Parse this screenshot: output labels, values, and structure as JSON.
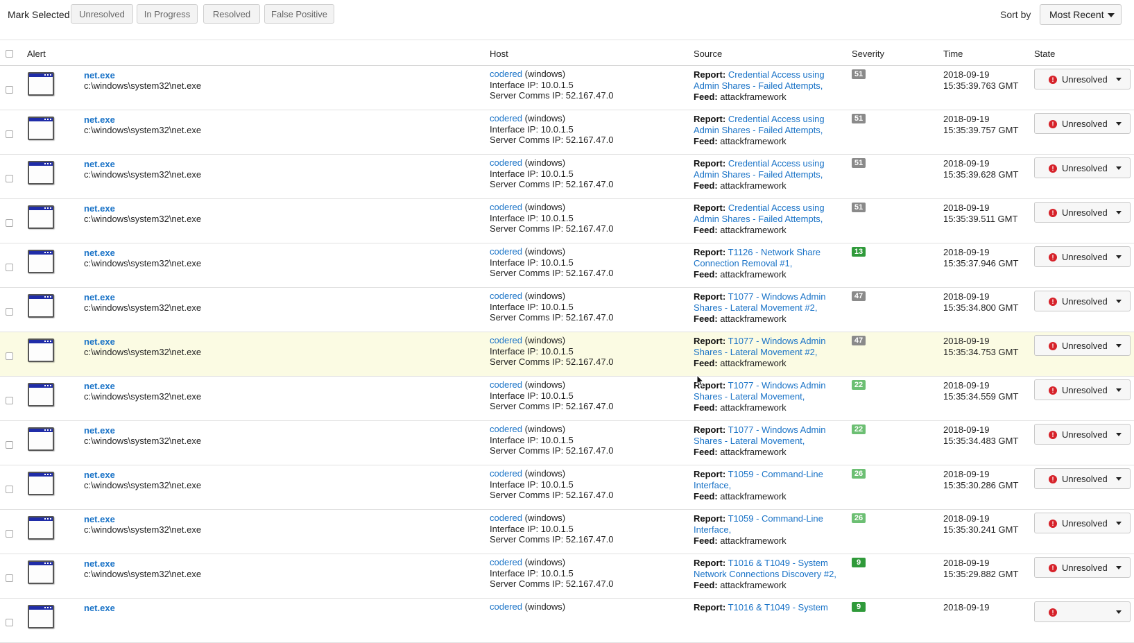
{
  "toolbar": {
    "mark_label": "Mark Selected",
    "buttons": [
      "Unresolved",
      "In Progress",
      "Resolved",
      "False Positive"
    ],
    "sort_label": "Sort by",
    "sort_value": "Most Recent"
  },
  "columns": {
    "alert": "Alert",
    "host": "Host",
    "source": "Source",
    "severity": "Severity",
    "time": "Time",
    "state": "State"
  },
  "colors": {
    "link": "#1a73c7",
    "sev_gray": "#8a8a8a",
    "sev_green": "#2f9a3a",
    "sev_light_green": "#6cbf73",
    "highlight_row": "#fbfbe3",
    "unresolved_icon": "#d6222a"
  },
  "icons": {
    "app": "application-window-icon",
    "state": "exclamation-circle-icon",
    "caret": "caret-down-icon"
  },
  "rows": [
    {
      "name": "net.exe",
      "path": "c:\\windows\\system32\\net.exe",
      "host_name": "codered",
      "host_os": "(windows)",
      "iface": "Interface IP: 10.0.1.5",
      "comms": "Server Comms IP: 52.167.47.0",
      "report_label": "Report:",
      "report_l1": "Credential Access using",
      "report_l2": "Admin Shares - Failed Attempts,",
      "feed_label": "Feed:",
      "feed": "attackframework",
      "severity": "51",
      "sev_color": "#8a8a8a",
      "date": "2018-09-19",
      "clock": "15:35:39.763 GMT",
      "state": "Unresolved"
    },
    {
      "name": "net.exe",
      "path": "c:\\windows\\system32\\net.exe",
      "host_name": "codered",
      "host_os": "(windows)",
      "iface": "Interface IP: 10.0.1.5",
      "comms": "Server Comms IP: 52.167.47.0",
      "report_label": "Report:",
      "report_l1": "Credential Access using",
      "report_l2": "Admin Shares - Failed Attempts,",
      "feed_label": "Feed:",
      "feed": "attackframework",
      "severity": "51",
      "sev_color": "#8a8a8a",
      "date": "2018-09-19",
      "clock": "15:35:39.757 GMT",
      "state": "Unresolved"
    },
    {
      "name": "net.exe",
      "path": "c:\\windows\\system32\\net.exe",
      "host_name": "codered",
      "host_os": "(windows)",
      "iface": "Interface IP: 10.0.1.5",
      "comms": "Server Comms IP: 52.167.47.0",
      "report_label": "Report:",
      "report_l1": "Credential Access using",
      "report_l2": "Admin Shares - Failed Attempts,",
      "feed_label": "Feed:",
      "feed": "attackframework",
      "severity": "51",
      "sev_color": "#8a8a8a",
      "date": "2018-09-19",
      "clock": "15:35:39.628 GMT",
      "state": "Unresolved"
    },
    {
      "name": "net.exe",
      "path": "c:\\windows\\system32\\net.exe",
      "host_name": "codered",
      "host_os": "(windows)",
      "iface": "Interface IP: 10.0.1.5",
      "comms": "Server Comms IP: 52.167.47.0",
      "report_label": "Report:",
      "report_l1": "Credential Access using",
      "report_l2": "Admin Shares - Failed Attempts,",
      "feed_label": "Feed:",
      "feed": "attackframework",
      "severity": "51",
      "sev_color": "#8a8a8a",
      "date": "2018-09-19",
      "clock": "15:35:39.511 GMT",
      "state": "Unresolved"
    },
    {
      "name": "net.exe",
      "path": "c:\\windows\\system32\\net.exe",
      "host_name": "codered",
      "host_os": "(windows)",
      "iface": "Interface IP: 10.0.1.5",
      "comms": "Server Comms IP: 52.167.47.0",
      "report_label": "Report:",
      "report_l1": "T1126 - Network Share",
      "report_l2": "Connection Removal #1,",
      "feed_label": "Feed:",
      "feed": "attackframework",
      "severity": "13",
      "sev_color": "#2f9a3a",
      "date": "2018-09-19",
      "clock": "15:35:37.946 GMT",
      "state": "Unresolved"
    },
    {
      "name": "net.exe",
      "path": "c:\\windows\\system32\\net.exe",
      "host_name": "codered",
      "host_os": "(windows)",
      "iface": "Interface IP: 10.0.1.5",
      "comms": "Server Comms IP: 52.167.47.0",
      "report_label": "Report:",
      "report_l1": "T1077 - Windows Admin",
      "report_l2": "Shares - Lateral Movement #2,",
      "feed_label": "Feed:",
      "feed": "attackframework",
      "severity": "47",
      "sev_color": "#8a8a8a",
      "date": "2018-09-19",
      "clock": "15:35:34.800 GMT",
      "state": "Unresolved"
    },
    {
      "name": "net.exe",
      "path": "c:\\windows\\system32\\net.exe",
      "host_name": "codered",
      "host_os": "(windows)",
      "iface": "Interface IP: 10.0.1.5",
      "comms": "Server Comms IP: 52.167.47.0",
      "report_label": "Report:",
      "report_l1": "T1077 - Windows Admin",
      "report_l2": "Shares - Lateral Movement #2,",
      "feed_label": "Feed:",
      "feed": "attackframework",
      "severity": "47",
      "sev_color": "#8a8a8a",
      "date": "2018-09-19",
      "clock": "15:35:34.753 GMT",
      "state": "Unresolved",
      "highlight": true
    },
    {
      "name": "net.exe",
      "path": "c:\\windows\\system32\\net.exe",
      "host_name": "codered",
      "host_os": "(windows)",
      "iface": "Interface IP: 10.0.1.5",
      "comms": "Server Comms IP: 52.167.47.0",
      "report_label": "Report:",
      "report_l1": "T1077 - Windows Admin",
      "report_l2": "Shares - Lateral Movement,",
      "feed_label": "Feed:",
      "feed": "attackframework",
      "severity": "22",
      "sev_color": "#6cbf73",
      "date": "2018-09-19",
      "clock": "15:35:34.559 GMT",
      "state": "Unresolved"
    },
    {
      "name": "net.exe",
      "path": "c:\\windows\\system32\\net.exe",
      "host_name": "codered",
      "host_os": "(windows)",
      "iface": "Interface IP: 10.0.1.5",
      "comms": "Server Comms IP: 52.167.47.0",
      "report_label": "Report:",
      "report_l1": "T1077 - Windows Admin",
      "report_l2": "Shares - Lateral Movement,",
      "feed_label": "Feed:",
      "feed": "attackframework",
      "severity": "22",
      "sev_color": "#6cbf73",
      "date": "2018-09-19",
      "clock": "15:35:34.483 GMT",
      "state": "Unresolved"
    },
    {
      "name": "net.exe",
      "path": "c:\\windows\\system32\\net.exe",
      "host_name": "codered",
      "host_os": "(windows)",
      "iface": "Interface IP: 10.0.1.5",
      "comms": "Server Comms IP: 52.167.47.0",
      "report_label": "Report:",
      "report_l1": "T1059 - Command-Line",
      "report_l2": "Interface,",
      "feed_label": "Feed:",
      "feed": "attackframework",
      "severity": "26",
      "sev_color": "#6cbf73",
      "date": "2018-09-19",
      "clock": "15:35:30.286 GMT",
      "state": "Unresolved"
    },
    {
      "name": "net.exe",
      "path": "c:\\windows\\system32\\net.exe",
      "host_name": "codered",
      "host_os": "(windows)",
      "iface": "Interface IP: 10.0.1.5",
      "comms": "Server Comms IP: 52.167.47.0",
      "report_label": "Report:",
      "report_l1": "T1059 - Command-Line",
      "report_l2": "Interface,",
      "feed_label": "Feed:",
      "feed": "attackframework",
      "severity": "26",
      "sev_color": "#6cbf73",
      "date": "2018-09-19",
      "clock": "15:35:30.241 GMT",
      "state": "Unresolved"
    },
    {
      "name": "net.exe",
      "path": "c:\\windows\\system32\\net.exe",
      "host_name": "codered",
      "host_os": "(windows)",
      "iface": "Interface IP: 10.0.1.5",
      "comms": "Server Comms IP: 52.167.47.0",
      "report_label": "Report:",
      "report_l1": "T1016 & T1049 - System",
      "report_l2": "Network Connections Discovery #2,",
      "feed_label": "Feed:",
      "feed": "attackframework",
      "severity": "9",
      "sev_color": "#2f9a3a",
      "date": "2018-09-19",
      "clock": "15:35:29.882 GMT",
      "state": "Unresolved"
    },
    {
      "name": "net.exe",
      "path": "",
      "host_name": "codered",
      "host_os": "(windows)",
      "iface": "",
      "comms": "",
      "report_label": "Report:",
      "report_l1": "T1016 & T1049 - System",
      "report_l2": "",
      "feed_label": "",
      "feed": "",
      "severity": "9",
      "sev_color": "#2f9a3a",
      "date": "2018-09-19",
      "clock": "",
      "state": ""
    }
  ]
}
